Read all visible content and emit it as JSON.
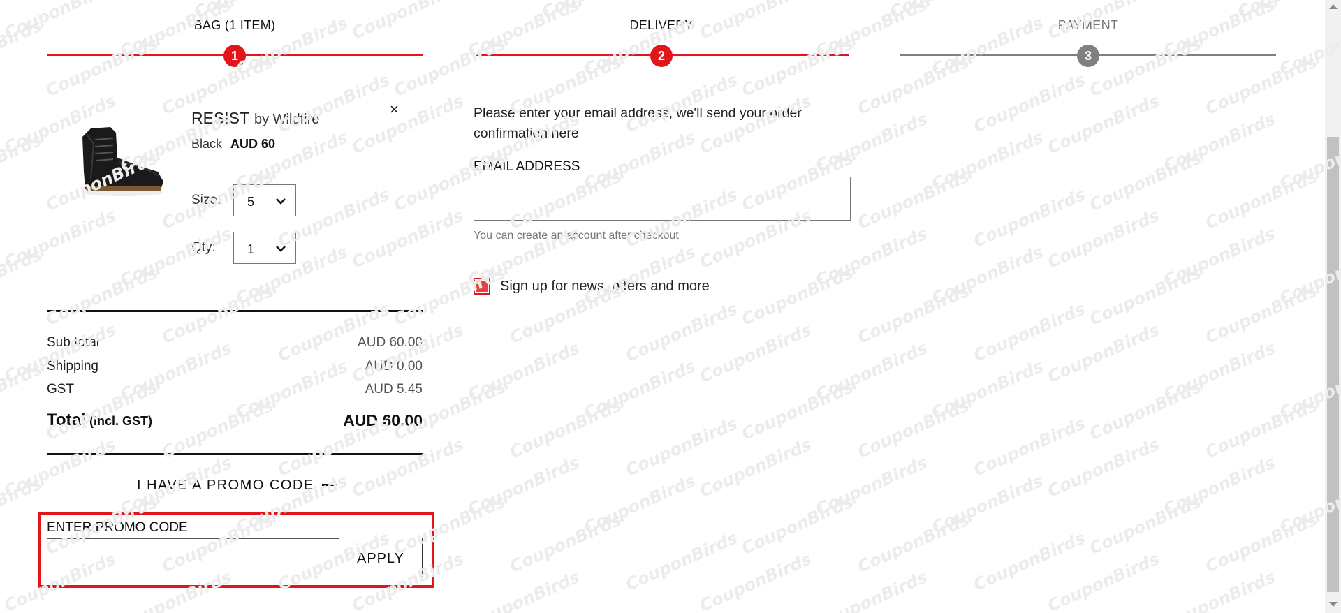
{
  "steps": [
    {
      "title": "BAG (1 ITEM)",
      "number": "1",
      "state": "active"
    },
    {
      "title": "DELIVERY",
      "number": "2",
      "state": "active"
    },
    {
      "title": "PAYMENT",
      "number": "3",
      "state": "inactive"
    }
  ],
  "colors": {
    "accent": "#e0161c",
    "inactive": "#808080",
    "text": "#111111"
  },
  "bag": {
    "product": {
      "name": "RESIST",
      "brand": "by Wildfire",
      "color": "Black",
      "price": "AUD 60",
      "image_icon": "black-boot-image",
      "remove_icon": "close-icon",
      "remove_glyph": "×"
    },
    "size": {
      "label": "Size:",
      "value": "5"
    },
    "qty": {
      "label": "Qty:",
      "value": "1"
    },
    "summary": {
      "subtotal": {
        "label": "Sub total",
        "value": "AUD 60.00"
      },
      "shipping": {
        "label": "Shipping",
        "value": "AUD 0.00"
      },
      "gst": {
        "label": "GST",
        "value": "AUD 5.45"
      },
      "total": {
        "label": "Total",
        "note": "(Incl. GST)",
        "value": "AUD 60.00"
      }
    },
    "promo": {
      "toggle_label": "I HAVE A PROMO CODE",
      "toggle_icon": "minus-icon",
      "field_label": "ENTER PROMO CODE",
      "input_value": "",
      "apply_label": "APPLY"
    }
  },
  "delivery": {
    "intro": "Please enter your email address, we'll send your order confirmation here",
    "email_label": "EMAIL ADDRESS",
    "email_value": "",
    "hint": "You can create an account after checkout",
    "newsletter_label": "Sign up for news, offers and more",
    "newsletter_checked": true
  },
  "watermark": "CouponBirds"
}
